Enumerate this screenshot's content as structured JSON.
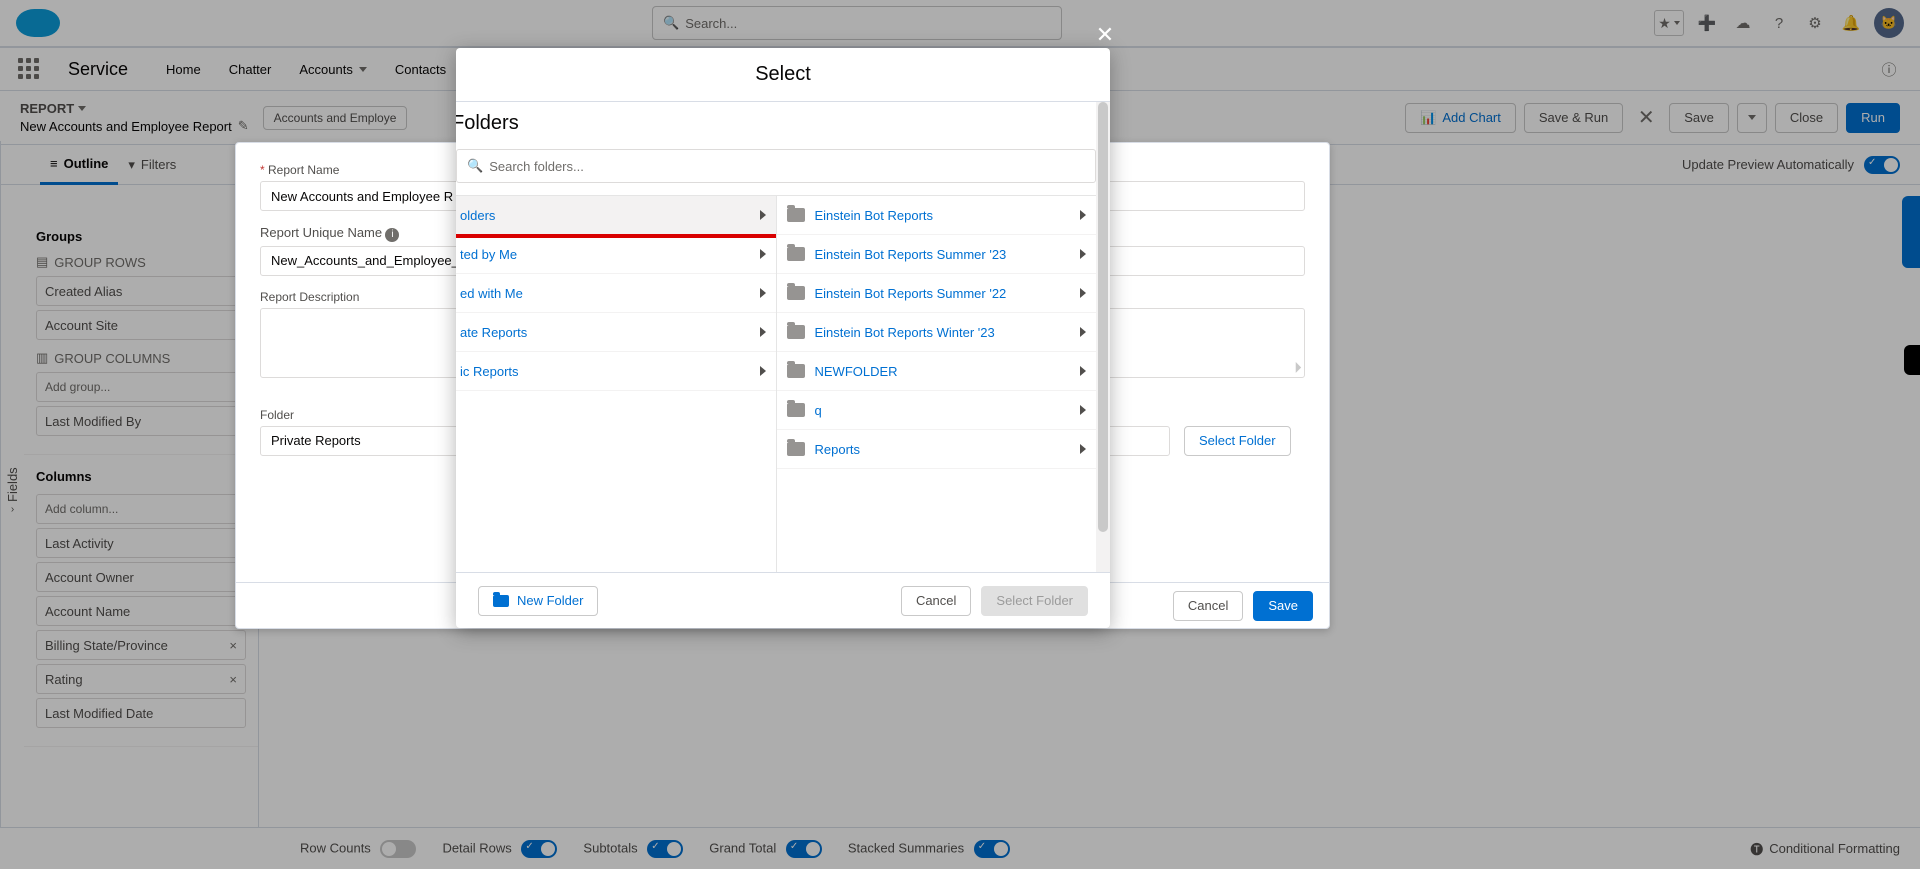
{
  "header": {
    "search_placeholder": "Search...",
    "app_name": "Service",
    "nav": [
      "Home",
      "Chatter",
      "Accounts",
      "Contacts"
    ],
    "more_label": ""
  },
  "page": {
    "crumb": "REPORT",
    "title": "New Accounts and Employee Report",
    "type_pill": "Accounts and Employe",
    "add_chart": "Add Chart",
    "save_run": "Save & Run",
    "save": "Save",
    "close": "Close",
    "run": "Run"
  },
  "toolbar2": {
    "outline": "Outline",
    "filters": "Filters",
    "update_label": "Update Preview Automatically"
  },
  "fields_rail": "Fields",
  "left_panel": {
    "groups_title": "Groups",
    "group_rows": "GROUP ROWS",
    "group_rows_items": [
      "Created Alias",
      "Account Site"
    ],
    "group_cols": "GROUP COLUMNS",
    "add_group_placeholder": "Add group...",
    "group_cols_items": [
      "Last Modified By"
    ],
    "columns_title": "Columns",
    "add_column_placeholder": "Add column...",
    "column_items": [
      "Last Activity",
      "Account Owner",
      "Account Name",
      "Billing State/Province",
      "Rating",
      "Last Modified Date"
    ]
  },
  "save_dialog": {
    "report_name_label": "Report Name",
    "report_name_value": "New Accounts and Employee R",
    "unique_name_label": "Report Unique Name",
    "unique_name_value": "New_Accounts_and_Employee_",
    "description_label": "Report Description",
    "folder_label": "Folder",
    "folder_value": "Private Reports",
    "select_folder": "Select Folder",
    "cancel": "Cancel",
    "save": "Save"
  },
  "status_bar": {
    "row_counts": "Row Counts",
    "detail_rows": "Detail Rows",
    "subtotals": "Subtotals",
    "grand_total": "Grand Total",
    "stacked": "Stacked Summaries",
    "cond_fmt": "Conditional Formatting"
  },
  "modal": {
    "title": "Select",
    "section_title": "Folders",
    "search_placeholder": "Search folders...",
    "left": [
      {
        "label": "olders",
        "selected": true,
        "highlight": true
      },
      {
        "label": "ted by Me"
      },
      {
        "label": "ed with Me"
      },
      {
        "label": "ate Reports"
      },
      {
        "label": "ic Reports"
      }
    ],
    "right": [
      {
        "label": "Einstein Bot Reports"
      },
      {
        "label": "Einstein Bot Reports Summer '23"
      },
      {
        "label": "Einstein Bot Reports Summer '22"
      },
      {
        "label": "Einstein Bot Reports Winter '23"
      },
      {
        "label": "NEWFOLDER"
      },
      {
        "label": "q"
      },
      {
        "label": "Reports"
      }
    ],
    "new_folder": "New Folder",
    "cancel": "Cancel",
    "select_folder": "Select Folder"
  }
}
